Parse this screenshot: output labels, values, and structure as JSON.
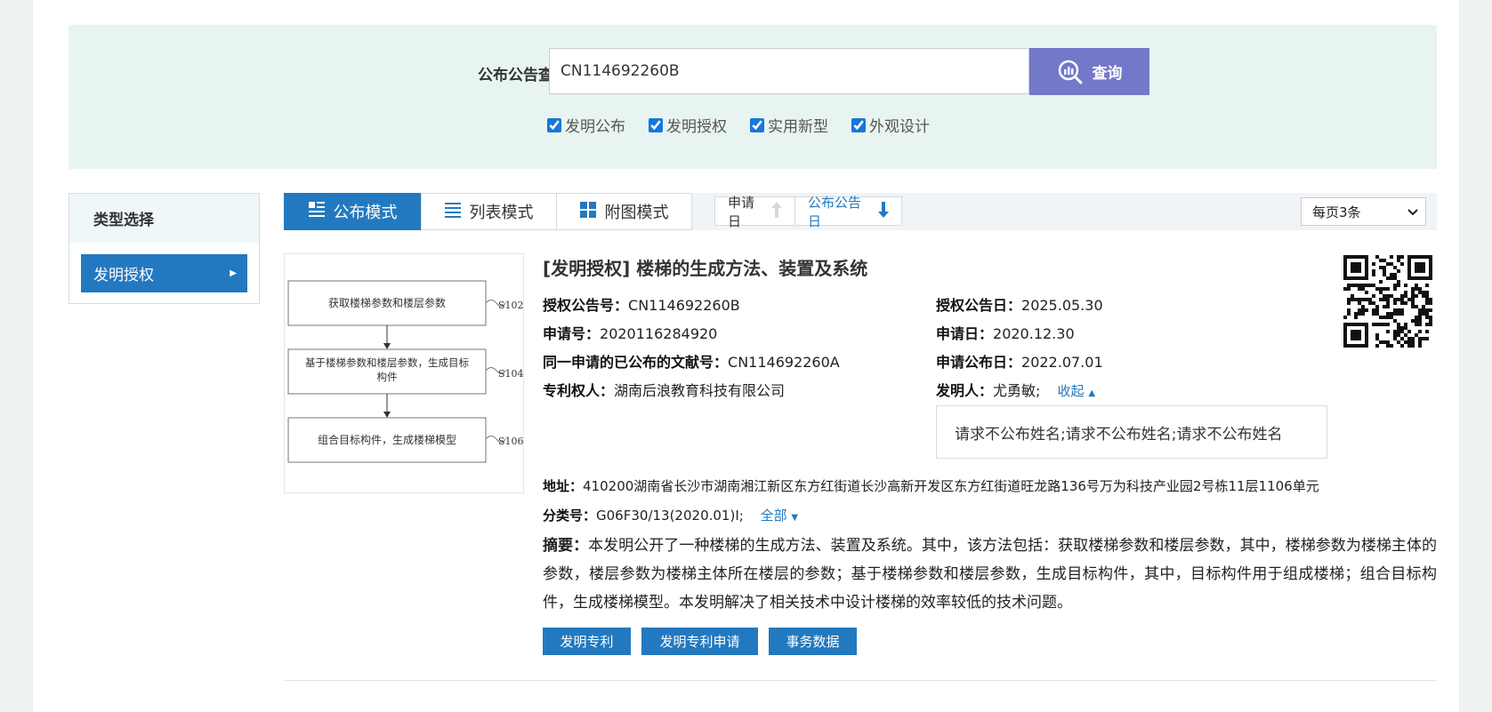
{
  "search": {
    "label": "公布公告查询",
    "value": "CN114692260B",
    "button_label": "查询",
    "options": [
      {
        "label": "发明公布",
        "checked": true
      },
      {
        "label": "发明授权",
        "checked": true
      },
      {
        "label": "实用新型",
        "checked": true
      },
      {
        "label": "外观设计",
        "checked": true
      }
    ]
  },
  "sidebar": {
    "heading": "类型选择",
    "items": [
      {
        "label": "发明授权",
        "active": true
      }
    ]
  },
  "toolbar": {
    "modes": [
      {
        "label": "公布模式",
        "icon": "doc-list-icon",
        "active": true
      },
      {
        "label": "列表模式",
        "icon": "list-icon",
        "active": false
      },
      {
        "label": "附图模式",
        "icon": "grid-icon",
        "active": false
      }
    ],
    "sorts": [
      {
        "label": "申请日",
        "direction": "up",
        "active": false
      },
      {
        "label": "公布公告日",
        "direction": "down",
        "active": true
      }
    ],
    "per_page": "每页3条"
  },
  "result": {
    "title": "[发明授权] 楼梯的生成方法、装置及系统",
    "diagram": {
      "steps": [
        {
          "text": "获取楼梯参数和楼层参数",
          "tag": "S102"
        },
        {
          "text": "基于楼梯参数和楼层参数，生成目标构件",
          "tag": "S104"
        },
        {
          "text": "组合目标构件，生成楼梯模型",
          "tag": "S106"
        }
      ]
    },
    "fields": {
      "grant_no_label": "授权公告号：",
      "grant_no": "CN114692260B",
      "grant_date_label": "授权公告日：",
      "grant_date": "2025.05.30",
      "app_no_label": "申请号：",
      "app_no": "2020116284920",
      "app_date_label": "申请日：",
      "app_date": "2020.12.30",
      "same_app_label": "同一申请的已公布的文献号：",
      "same_app": "CN114692260A",
      "pub_date_label": "申请公布日：",
      "pub_date": "2022.07.01",
      "patentee_label": "专利权人：",
      "patentee": "湖南后浪教育科技有限公司",
      "inventor_label": "发明人：",
      "inventor": "尤勇敏;",
      "collapse_label": "收起",
      "inventor_more": "请求不公布姓名;请求不公布姓名;请求不公布姓名",
      "address_label": "地址：",
      "address": "410200湖南省长沙市湖南湘江新区东方红街道长沙高新开发区东方红街道旺龙路136号万为科技产业园2号栋11层1106单元",
      "class_label": "分类号：",
      "class_value": "G06F30/13(2020.01)I;",
      "class_all_label": "全部",
      "abstract_label": "摘要：",
      "abstract": "本发明公开了一种楼梯的生成方法、装置及系统。其中，该方法包括：获取楼梯参数和楼层参数，其中，楼梯参数为楼梯主体的参数，楼层参数为楼梯主体所在楼层的参数；基于楼梯参数和楼层参数，生成目标构件，其中，目标构件用于组成楼梯；组合目标构件，生成楼梯模型。本发明解决了相关技术中设计楼梯的效率较低的技术问题。"
    },
    "actions": [
      "发明专利",
      "发明专利申请",
      "事务数据"
    ]
  }
}
